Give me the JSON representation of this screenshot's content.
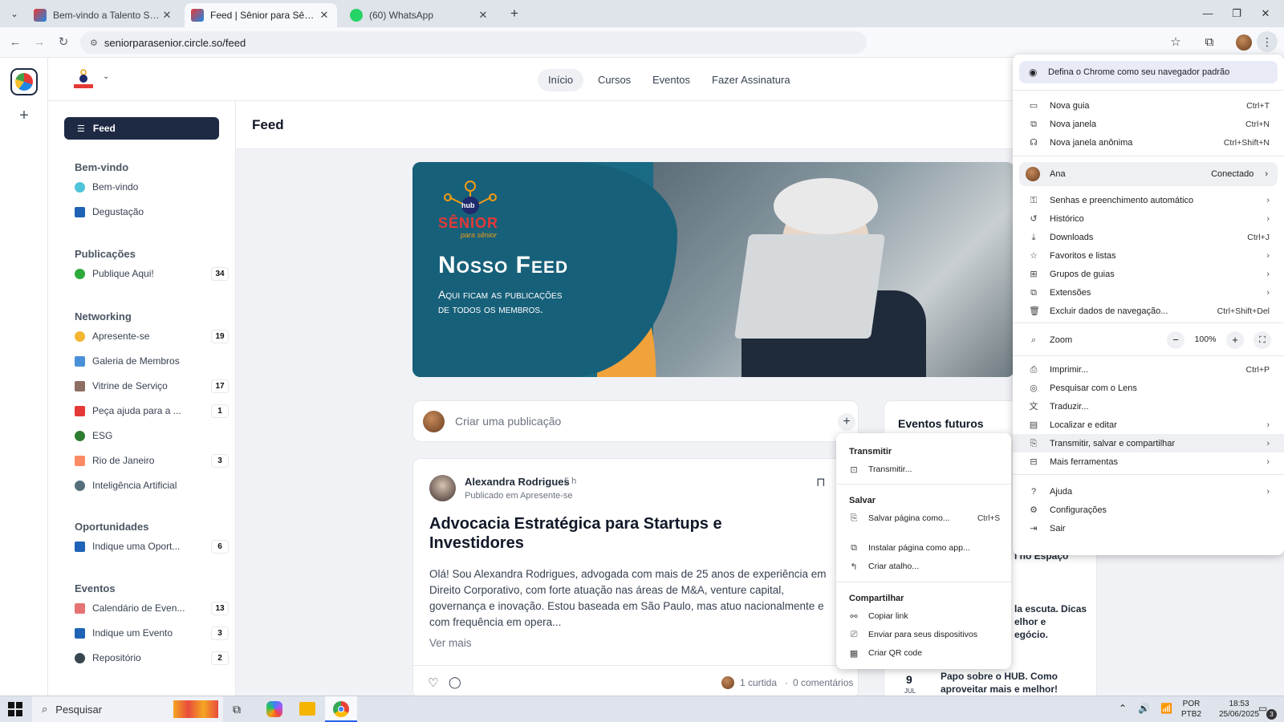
{
  "browser": {
    "tabs": [
      {
        "title": "Bem-vindo a Talento Senior | Ta",
        "close": "✕"
      },
      {
        "title": "Feed | Sênior para Sênior",
        "close": "✕"
      },
      {
        "title": "(60) WhatsApp",
        "close": "✕"
      }
    ],
    "new_tab": "+",
    "url": "seniorparasenior.circle.so/feed"
  },
  "site": {
    "nav": [
      "Início",
      "Cursos",
      "Eventos",
      "Fazer Assinatura"
    ],
    "feed_button": "Feed",
    "page_title": "Feed"
  },
  "sidebar": {
    "sections": [
      {
        "title": "Bem-vindo",
        "items": [
          {
            "label": "Bem-vindo",
            "count": ""
          },
          {
            "label": "Degustação",
            "count": ""
          }
        ]
      },
      {
        "title": "Publicações",
        "items": [
          {
            "label": "Publique Aqui!",
            "count": "34"
          }
        ]
      },
      {
        "title": "Networking",
        "items": [
          {
            "label": "Apresente-se",
            "count": "19"
          },
          {
            "label": "Galeria de Membros",
            "count": ""
          },
          {
            "label": "Vitrine de Serviço",
            "count": "17"
          },
          {
            "label": "Peça ajuda para a ...",
            "count": "1"
          },
          {
            "label": "ESG",
            "count": ""
          },
          {
            "label": "Rio de Janeiro",
            "count": "3"
          },
          {
            "label": "Inteligência Artificial",
            "count": ""
          }
        ]
      },
      {
        "title": "Oportunidades",
        "items": [
          {
            "label": "Indique uma Oport...",
            "count": "6"
          }
        ]
      },
      {
        "title": "Eventos",
        "items": [
          {
            "label": "Calendário de Even...",
            "count": "13"
          },
          {
            "label": "Indique um Evento",
            "count": "3"
          },
          {
            "label": "Repositório",
            "count": "2"
          }
        ]
      }
    ]
  },
  "banner": {
    "logo_hub": "hub",
    "logo_senior": "SÊNIOR",
    "logo_sub": "para sênior",
    "headline": "Nosso Feed",
    "line1": "Aqui ficam as publicações",
    "line2": "de todos os membros."
  },
  "composer": {
    "placeholder": "Criar uma publicação",
    "plus": "+"
  },
  "post": {
    "author": "Alexandra Rodrigues",
    "time": "5 h",
    "published_in": "Publicado em Apresente-se",
    "title_line1": "Advocacia Estratégica para Startups e",
    "title_line2": "Investidores",
    "body": "Olá! Sou Alexandra Rodrigues, advogada com mais de 25 anos de experiência em Direito Corporativo, com forte atuação nas áreas de M&A, venture capital, governança e inovação. Estou baseada em São Paulo, mas atuo nacionalmente e com frequência em opera...",
    "more": "Ver mais",
    "likes": "1 curtida",
    "dot": "·",
    "comments": "0 comentários"
  },
  "events": {
    "title": "Eventos futuros",
    "frag1": "l no Espaço",
    "frag2a": "la escuta. Dicas",
    "frag2b": "elhor e",
    "frag2c": "egócio.",
    "day": "9",
    "month": "JUL",
    "ev_line1": "Papo sobre o HUB. Como",
    "ev_line2": "aproveitar mais e melhor!"
  },
  "chrome_menu": {
    "banner": "Defina o Chrome como seu navegador padrão",
    "new_tab": "Nova guia",
    "new_tab_sc": "Ctrl+T",
    "new_window": "Nova janela",
    "new_window_sc": "Ctrl+N",
    "incognito": "Nova janela anônima",
    "incognito_sc": "Ctrl+Shift+N",
    "profile": "Ana",
    "profile_status": "Conectado",
    "passwords": "Senhas e preenchimento automático",
    "history": "Histórico",
    "downloads": "Downloads",
    "downloads_sc": "Ctrl+J",
    "bookmarks": "Favoritos e listas",
    "tab_groups": "Grupos de guias",
    "extensions": "Extensões",
    "clear": "Excluir dados de navegação...",
    "clear_sc": "Ctrl+Shift+Del",
    "zoom": "Zoom",
    "zoom_minus": "−",
    "zoom_value": "100%",
    "zoom_plus": "+",
    "print": "Imprimir...",
    "print_sc": "Ctrl+P",
    "lens": "Pesquisar com o Lens",
    "translate": "Traduzir...",
    "find": "Localizar e editar",
    "cast_save_share": "Transmitir, salvar e compartilhar",
    "more_tools": "Mais ferramentas",
    "help": "Ajuda",
    "settings": "Configurações",
    "exit": "Sair"
  },
  "submenu": {
    "h_cast": "Transmitir",
    "cast": "Transmitir...",
    "h_save": "Salvar",
    "save_page": "Salvar página como...",
    "save_page_sc": "Ctrl+S",
    "install": "Instalar página como app...",
    "shortcut": "Criar atalho...",
    "h_share": "Compartilhar",
    "copy_link": "Copiar link",
    "send_devices": "Enviar para seus dispositivos",
    "qr": "Criar QR code"
  },
  "taskbar": {
    "search": "Pesquisar",
    "lang1": "POR",
    "lang2": "PTB2",
    "time": "18:53",
    "date": "25/06/2025",
    "notif": "3"
  }
}
